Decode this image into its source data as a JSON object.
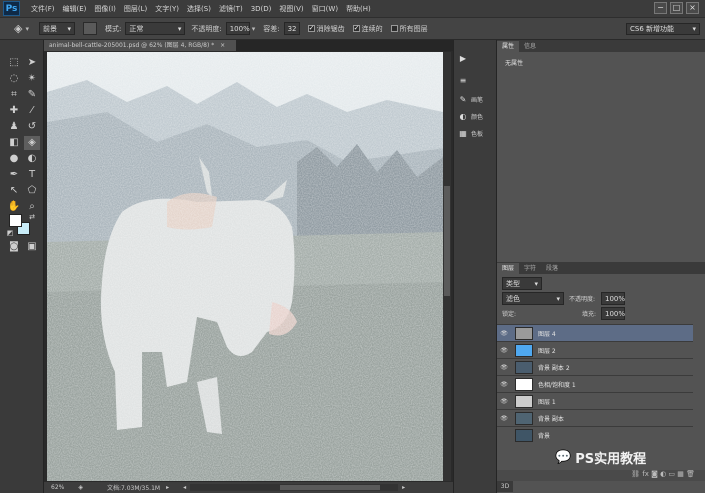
{
  "app": {
    "logo": "Ps"
  },
  "menu": [
    "文件(F)",
    "编辑(E)",
    "图像(I)",
    "图层(L)",
    "文字(Y)",
    "选择(S)",
    "滤镜(T)",
    "3D(D)",
    "视图(V)",
    "窗口(W)",
    "帮助(H)"
  ],
  "window_controls": [
    "−",
    "□",
    "×"
  ],
  "options": {
    "preset": "前景",
    "mode_label": "模式:",
    "mode_value": "正常",
    "opacity_label": "不透明度:",
    "opacity_value": "100%",
    "tolerance_label": "容差:",
    "tolerance_value": "32",
    "antialias_label": "消除锯齿",
    "contiguous_label": "连续的",
    "all_layers_label": "所有图层",
    "workspace": "CS6 新增功能"
  },
  "document": {
    "tab_title": "animal-bell-cattle-205001.psd @ 62% (图层 4, RGB/8) *",
    "close": "×",
    "zoom": "62%",
    "doc_info": "文档:7.03M/35.1M"
  },
  "mini_panels": [
    "",
    "",
    "画笔",
    "颜色",
    "色板"
  ],
  "properties": {
    "tabs": [
      "属性",
      "信息"
    ],
    "content": "无属性"
  },
  "layers_panel": {
    "tabs": [
      "图层",
      "字符",
      "段落"
    ],
    "filter": "类型",
    "blend": "滤色",
    "opacity_label": "不透明度:",
    "opacity_value": "100%",
    "lock_label": "锁定:",
    "fill_label": "填充:",
    "fill_value": "100%",
    "layers": [
      {
        "name": "图层 4",
        "thumb_color": "#9a9a9a",
        "selected": true
      },
      {
        "name": "图层 2",
        "thumb_color": "#4fa8f0",
        "selected": false
      },
      {
        "name": "背景 副本 2",
        "thumb_color": "#4a5d6e",
        "selected": false
      },
      {
        "name": "色相/饱和度 1",
        "thumb_color": "#ffffff",
        "selected": false
      },
      {
        "name": "图层 1",
        "thumb_color": "#cccccc",
        "selected": false
      },
      {
        "name": "背景 副本",
        "thumb_color": "#4f6472",
        "selected": false
      },
      {
        "name": "背景",
        "thumb_color": "#3f5566",
        "selected": false
      }
    ]
  },
  "colors": {
    "foreground": "#ffffff",
    "background": "#c8ecf7",
    "selected_layer": "#5d6c86"
  },
  "watermark": "PS实用教程",
  "bottom_tab": "3D"
}
